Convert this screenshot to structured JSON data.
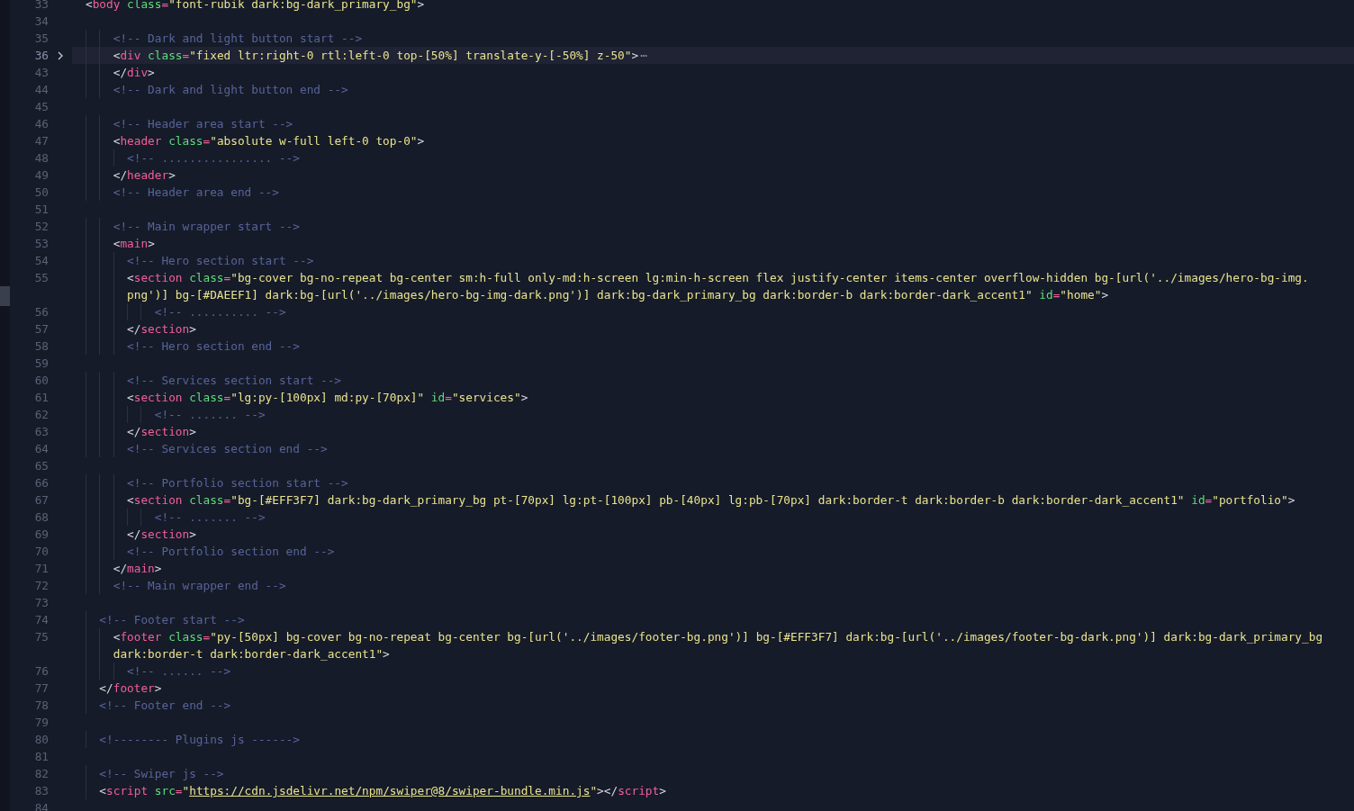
{
  "editor": {
    "lines": [
      {
        "number": "33",
        "rows": [
          {
            "tokens": [
              {
                "kind": "p",
                "text": "<"
              },
              {
                "kind": "tag",
                "text": "body"
              },
              {
                "kind": "attr",
                "text": " class"
              },
              {
                "kind": "eq",
                "text": "="
              },
              {
                "kind": "str",
                "text": "\"font-rubik dark:bg-dark_primary_bg\""
              },
              {
                "kind": "p",
                "text": ">"
              }
            ]
          }
        ]
      },
      {
        "number": "34"
      },
      {
        "number": "35",
        "rows": [
          {
            "tokens": [
              {
                "kind": "com",
                "text": "    <!-- Dark and light button start -->"
              }
            ]
          }
        ]
      },
      {
        "number": "36",
        "current": true,
        "folded": true,
        "fold_marker": "⋯",
        "rows": [
          {
            "tokens": [
              {
                "kind": "p",
                "text": "    <"
              },
              {
                "kind": "tag",
                "text": "div"
              },
              {
                "kind": "attr",
                "text": " class"
              },
              {
                "kind": "eq",
                "text": "="
              },
              {
                "kind": "str",
                "text": "\"fixed ltr:right-0 rtl:left-0 top-[50%] translate-y-[-50%] z-50\""
              },
              {
                "kind": "p",
                "text": ">"
              }
            ]
          }
        ]
      },
      {
        "number": "43",
        "rows": [
          {
            "tokens": [
              {
                "kind": "p",
                "text": "    </"
              },
              {
                "kind": "tag",
                "text": "div"
              },
              {
                "kind": "p",
                "text": ">"
              }
            ]
          }
        ]
      },
      {
        "number": "44",
        "rows": [
          {
            "tokens": [
              {
                "kind": "com",
                "text": "    <!-- Dark and light button end -->"
              }
            ]
          }
        ]
      },
      {
        "number": "45"
      },
      {
        "number": "46",
        "rows": [
          {
            "tokens": [
              {
                "kind": "com",
                "text": "    <!-- Header area start -->"
              }
            ]
          }
        ]
      },
      {
        "number": "47",
        "rows": [
          {
            "tokens": [
              {
                "kind": "p",
                "text": "    <"
              },
              {
                "kind": "tag",
                "text": "header"
              },
              {
                "kind": "attr",
                "text": " class"
              },
              {
                "kind": "eq",
                "text": "="
              },
              {
                "kind": "str",
                "text": "\"absolute w-full left-0 top-0\""
              },
              {
                "kind": "p",
                "text": ">"
              }
            ]
          }
        ]
      },
      {
        "number": "48",
        "rows": [
          {
            "tokens": [
              {
                "kind": "com",
                "text": "      <!-- ................ -->"
              }
            ]
          }
        ]
      },
      {
        "number": "49",
        "rows": [
          {
            "tokens": [
              {
                "kind": "p",
                "text": "    </"
              },
              {
                "kind": "tag",
                "text": "header"
              },
              {
                "kind": "p",
                "text": ">"
              }
            ]
          }
        ]
      },
      {
        "number": "50",
        "rows": [
          {
            "tokens": [
              {
                "kind": "com",
                "text": "    <!-- Header area end -->"
              }
            ]
          }
        ]
      },
      {
        "number": "51"
      },
      {
        "number": "52",
        "rows": [
          {
            "tokens": [
              {
                "kind": "com",
                "text": "    <!-- Main wrapper start -->"
              }
            ]
          }
        ]
      },
      {
        "number": "53",
        "rows": [
          {
            "tokens": [
              {
                "kind": "p",
                "text": "    <"
              },
              {
                "kind": "tag",
                "text": "main"
              },
              {
                "kind": "p",
                "text": ">"
              }
            ]
          }
        ]
      },
      {
        "number": "54",
        "rows": [
          {
            "tokens": [
              {
                "kind": "com",
                "text": "      <!-- Hero section start -->"
              }
            ]
          }
        ]
      },
      {
        "number": "55",
        "rows": [
          {
            "tokens": [
              {
                "kind": "p",
                "text": "      <"
              },
              {
                "kind": "tag",
                "text": "section"
              },
              {
                "kind": "attr",
                "text": " class"
              },
              {
                "kind": "eq",
                "text": "="
              },
              {
                "kind": "str",
                "text": "\"bg-cover bg-no-repeat bg-center sm:h-full only-md:h-screen lg:min-h-screen flex justify-center items-center overflow-hidden bg-[url('../images/hero-bg-img."
              }
            ]
          },
          {
            "tokens": [
              {
                "kind": "str",
                "text": "      png')] bg-[#DAEEF1] dark:bg-[url('../images/hero-bg-img-dark.png')] dark:bg-dark_primary_bg dark:border-b dark:border-dark_accent1\""
              },
              {
                "kind": "attr",
                "text": " id"
              },
              {
                "kind": "eq",
                "text": "="
              },
              {
                "kind": "str",
                "text": "\"home\""
              },
              {
                "kind": "p",
                "text": ">"
              }
            ]
          }
        ]
      },
      {
        "number": "56",
        "rows": [
          {
            "tokens": [
              {
                "kind": "com",
                "text": "          <!-- .......... -->"
              }
            ]
          }
        ]
      },
      {
        "number": "57",
        "rows": [
          {
            "tokens": [
              {
                "kind": "p",
                "text": "      </"
              },
              {
                "kind": "tag",
                "text": "section"
              },
              {
                "kind": "p",
                "text": ">"
              }
            ]
          }
        ]
      },
      {
        "number": "58",
        "rows": [
          {
            "tokens": [
              {
                "kind": "com",
                "text": "      <!-- Hero section end -->"
              }
            ]
          }
        ]
      },
      {
        "number": "59"
      },
      {
        "number": "60",
        "rows": [
          {
            "tokens": [
              {
                "kind": "com",
                "text": "      <!-- Services section start -->"
              }
            ]
          }
        ]
      },
      {
        "number": "61",
        "rows": [
          {
            "tokens": [
              {
                "kind": "p",
                "text": "      <"
              },
              {
                "kind": "tag",
                "text": "section"
              },
              {
                "kind": "attr",
                "text": " class"
              },
              {
                "kind": "eq",
                "text": "="
              },
              {
                "kind": "str",
                "text": "\"lg:py-[100px] md:py-[70px]\""
              },
              {
                "kind": "attr",
                "text": " id"
              },
              {
                "kind": "eq",
                "text": "="
              },
              {
                "kind": "str",
                "text": "\"services\""
              },
              {
                "kind": "p",
                "text": ">"
              }
            ]
          }
        ]
      },
      {
        "number": "62",
        "rows": [
          {
            "tokens": [
              {
                "kind": "com",
                "text": "          <!-- ....... -->"
              }
            ]
          }
        ]
      },
      {
        "number": "63",
        "rows": [
          {
            "tokens": [
              {
                "kind": "p",
                "text": "      </"
              },
              {
                "kind": "tag",
                "text": "section"
              },
              {
                "kind": "p",
                "text": ">"
              }
            ]
          }
        ]
      },
      {
        "number": "64",
        "rows": [
          {
            "tokens": [
              {
                "kind": "com",
                "text": "      <!-- Services section end -->"
              }
            ]
          }
        ]
      },
      {
        "number": "65"
      },
      {
        "number": "66",
        "rows": [
          {
            "tokens": [
              {
                "kind": "com",
                "text": "      <!-- Portfolio section start -->"
              }
            ]
          }
        ]
      },
      {
        "number": "67",
        "rows": [
          {
            "tokens": [
              {
                "kind": "p",
                "text": "      <"
              },
              {
                "kind": "tag",
                "text": "section"
              },
              {
                "kind": "attr",
                "text": " class"
              },
              {
                "kind": "eq",
                "text": "="
              },
              {
                "kind": "str",
                "text": "\"bg-[#EFF3F7] dark:bg-dark_primary_bg pt-[70px] lg:pt-[100px] pb-[40px] lg:pb-[70px] dark:border-t dark:border-b dark:border-dark_accent1\""
              },
              {
                "kind": "attr",
                "text": " id"
              },
              {
                "kind": "eq",
                "text": "="
              },
              {
                "kind": "str",
                "text": "\"portfolio\""
              },
              {
                "kind": "p",
                "text": ">"
              }
            ]
          }
        ]
      },
      {
        "number": "68",
        "rows": [
          {
            "tokens": [
              {
                "kind": "com",
                "text": "          <!-- ....... -->"
              }
            ]
          }
        ]
      },
      {
        "number": "69",
        "rows": [
          {
            "tokens": [
              {
                "kind": "p",
                "text": "      </"
              },
              {
                "kind": "tag",
                "text": "section"
              },
              {
                "kind": "p",
                "text": ">"
              }
            ]
          }
        ]
      },
      {
        "number": "70",
        "rows": [
          {
            "tokens": [
              {
                "kind": "com",
                "text": "      <!-- Portfolio section end -->"
              }
            ]
          }
        ]
      },
      {
        "number": "71",
        "rows": [
          {
            "tokens": [
              {
                "kind": "p",
                "text": "    </"
              },
              {
                "kind": "tag",
                "text": "main"
              },
              {
                "kind": "p",
                "text": ">"
              }
            ]
          }
        ]
      },
      {
        "number": "72",
        "rows": [
          {
            "tokens": [
              {
                "kind": "com",
                "text": "    <!-- Main wrapper end -->"
              }
            ]
          }
        ]
      },
      {
        "number": "73"
      },
      {
        "number": "74",
        "rows": [
          {
            "tokens": [
              {
                "kind": "com",
                "text": "  <!-- Footer start -->"
              }
            ]
          }
        ]
      },
      {
        "number": "75",
        "rows": [
          {
            "tokens": [
              {
                "kind": "p",
                "text": "    <"
              },
              {
                "kind": "tag",
                "text": "footer"
              },
              {
                "kind": "attr",
                "text": " class"
              },
              {
                "kind": "eq",
                "text": "="
              },
              {
                "kind": "str",
                "text": "\"py-[50px] bg-cover bg-no-repeat bg-center bg-[url('../images/footer-bg.png')] bg-[#EFF3F7] dark:bg-[url('../images/footer-bg-dark.png')] dark:bg-dark_primary_bg"
              }
            ]
          },
          {
            "tokens": [
              {
                "kind": "str",
                "text": "    dark:border-t dark:border-dark_accent1\""
              },
              {
                "kind": "p",
                "text": ">"
              }
            ]
          }
        ]
      },
      {
        "number": "76",
        "rows": [
          {
            "tokens": [
              {
                "kind": "com",
                "text": "      <!-- ...... -->"
              }
            ]
          }
        ]
      },
      {
        "number": "77",
        "rows": [
          {
            "tokens": [
              {
                "kind": "p",
                "text": "  </"
              },
              {
                "kind": "tag",
                "text": "footer"
              },
              {
                "kind": "p",
                "text": ">"
              }
            ]
          }
        ]
      },
      {
        "number": "78",
        "rows": [
          {
            "tokens": [
              {
                "kind": "com",
                "text": "  <!-- Footer end -->"
              }
            ]
          }
        ]
      },
      {
        "number": "79"
      },
      {
        "number": "80",
        "rows": [
          {
            "tokens": [
              {
                "kind": "com",
                "text": "  <!-------- Plugins js ------>"
              }
            ]
          }
        ]
      },
      {
        "number": "81"
      },
      {
        "number": "82",
        "rows": [
          {
            "tokens": [
              {
                "kind": "com",
                "text": "  <!-- Swiper js -->"
              }
            ]
          }
        ]
      },
      {
        "number": "83",
        "rows": [
          {
            "tokens": [
              {
                "kind": "p",
                "text": "  <"
              },
              {
                "kind": "tag",
                "text": "script"
              },
              {
                "kind": "attr",
                "text": " src"
              },
              {
                "kind": "eq",
                "text": "="
              },
              {
                "kind": "str",
                "text": "\""
              },
              {
                "kind": "link",
                "text": "https://cdn.jsdelivr.net/npm/swiper@8/swiper-bundle.min.js"
              },
              {
                "kind": "str",
                "text": "\""
              },
              {
                "kind": "p",
                "text": "></"
              },
              {
                "kind": "tag",
                "text": "script"
              },
              {
                "kind": "p",
                "text": ">"
              }
            ]
          }
        ]
      },
      {
        "number": "84"
      }
    ]
  }
}
